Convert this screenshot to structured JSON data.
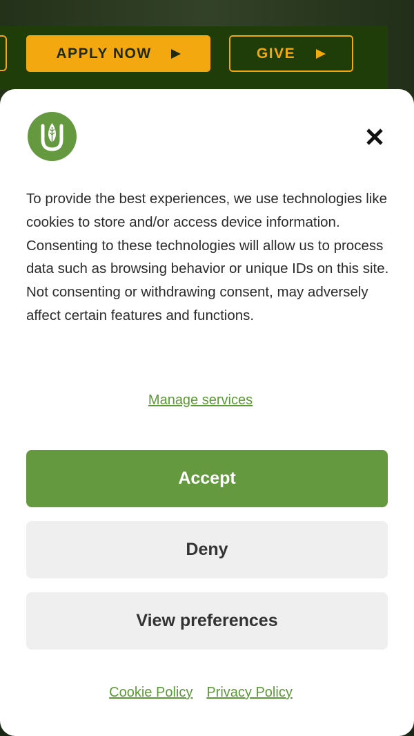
{
  "site_header": {
    "apply_label": "APPLY NOW",
    "give_label": "GIVE",
    "accent_color": "#f4a80f",
    "bar_color": "#1f3d08"
  },
  "consent_dialog": {
    "logo_icon": "university-wheat-logo-icon",
    "close_icon": "close-icon",
    "message": "To provide the best experiences, we use technologies like cookies to store and/or access device information. Consenting to these technologies will allow us to process data such as browsing behavior or unique IDs on this site. Not consenting or withdrawing consent, may adversely affect certain features and functions.",
    "manage_services_label": "Manage services",
    "accept_label": "Accept",
    "deny_label": "Deny",
    "view_preferences_label": "View preferences",
    "cookie_policy_label": "Cookie Policy",
    "privacy_policy_label": "Privacy Policy",
    "primary_color": "#65993f",
    "link_color": "#5a9a34"
  }
}
